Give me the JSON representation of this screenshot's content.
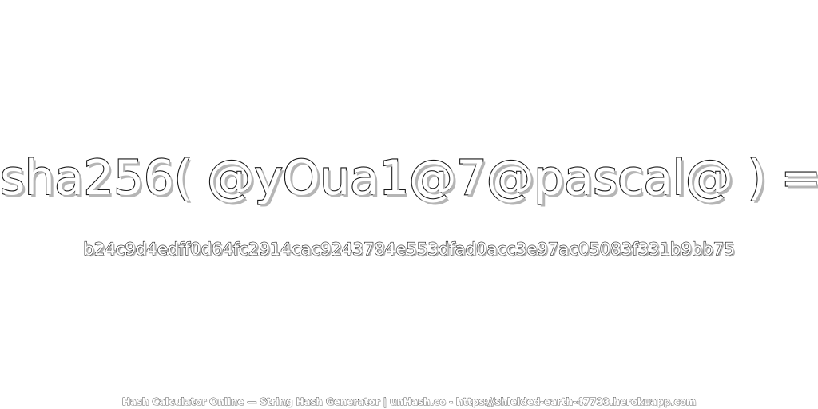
{
  "headline": "sha256( @yOua1@7@pascal@ ) =",
  "hash_value": "b24c9d4edff0d64fc2914cac9243784e553dfad0acc3e97ac05083f331b9bb75",
  "footer": "Hash Calculator Online — String Hash Generator | unHash.co - https://shielded-earth-47733.herokuapp.com",
  "colors": {
    "text_fill": "#ffffff",
    "text_stroke": "#1a1a1a",
    "shadow": "#b5b5b5",
    "background": "#ffffff"
  }
}
